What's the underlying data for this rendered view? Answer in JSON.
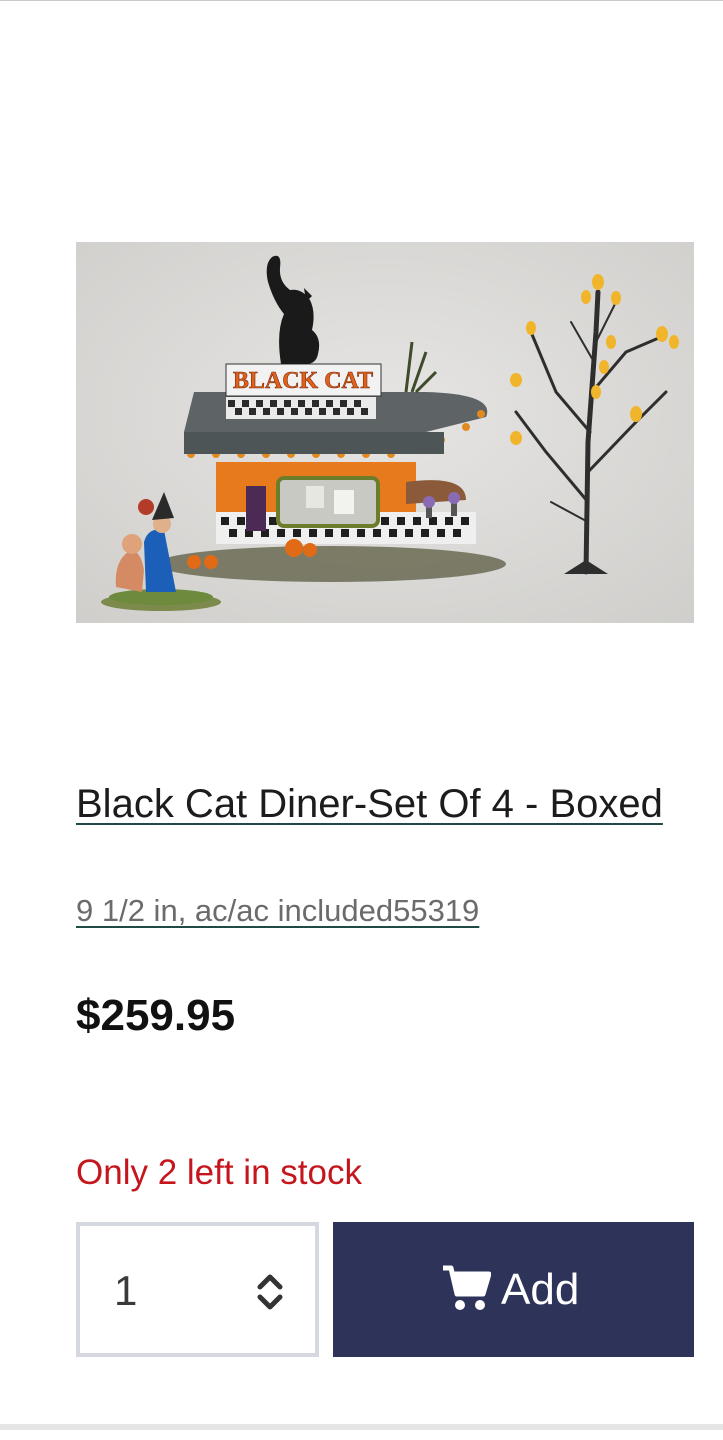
{
  "product": {
    "image_alt": "Black Cat Diner village building with figurines and tree",
    "image_sign_text": "BLACK CAT",
    "title": "Black Cat Diner-Set Of 4 - Boxed",
    "subtitle": "9 1/2 in, ac/ac included55319",
    "price": "$259.95",
    "stock_message": "Only 2 left in stock"
  },
  "cart": {
    "quantity": "1",
    "add_label": "Add",
    "icon": "cart-icon",
    "stepper_icon": "chevron-updown-icon"
  },
  "colors": {
    "accent_button": "#2d3359",
    "stock_warning": "#c4161c",
    "link_underline": "#1f4a46"
  }
}
